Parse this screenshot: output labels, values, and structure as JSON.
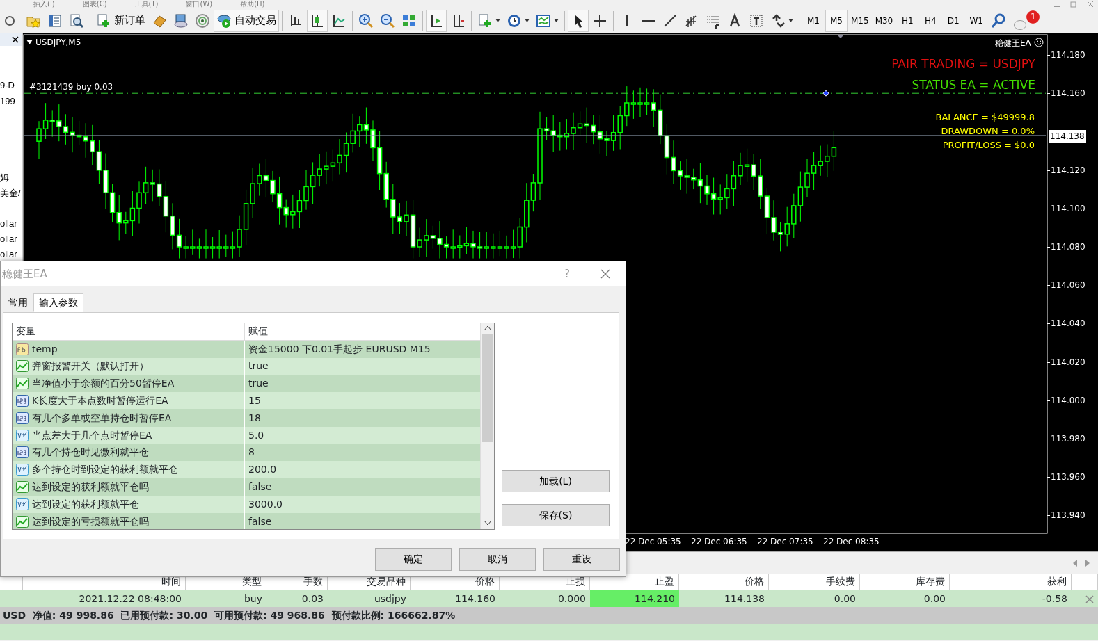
{
  "menu": [
    "插入(I)",
    "图表(C)",
    "工具(T)",
    "窗口(W)",
    "帮助(H)"
  ],
  "toolbar": {
    "new_order": "新订单",
    "auto_trading": "自动交易",
    "notification_count": "1",
    "timeframes": [
      {
        "label": "M1",
        "selected": false
      },
      {
        "label": "M5",
        "selected": true
      },
      {
        "label": "M15",
        "selected": false
      },
      {
        "label": "M30",
        "selected": false
      },
      {
        "label": "H1",
        "selected": false
      },
      {
        "label": "H4",
        "selected": false
      },
      {
        "label": "D1",
        "selected": false
      },
      {
        "label": "W1",
        "selected": false
      }
    ]
  },
  "navigator": {
    "fragments": [
      "9-D",
      "199",
      "姆",
      "美金/",
      "ollar",
      "ollar",
      "ollar"
    ]
  },
  "chart": {
    "title": "USDJPY,M5",
    "order_label": "#3121439 buy 0.03",
    "ea_name": "稳健王EA",
    "pair_line": "PAIR TRADING = USDJPY",
    "status_line": "STATUS EA = ACTIVE",
    "stats": [
      "BALANCE = $49999.8",
      "DRAWDOWN = 0.0%",
      "PROFIT/LOSS = $0.0"
    ],
    "price_axis": [
      "114.180",
      "114.160",
      "114.120",
      "114.100",
      "114.080",
      "114.060",
      "114.040",
      "114.020",
      "114.000",
      "113.980",
      "113.960",
      "113.940"
    ],
    "current_price": "114.138",
    "time_axis": [
      "22 Dec 05:35",
      "22 Dec 06:35",
      "22 Dec 07:35",
      "22 Dec 08:35"
    ]
  },
  "dialog": {
    "title": "稳健王EA",
    "help": "?",
    "tabs": [
      {
        "label": "常用",
        "selected": false
      },
      {
        "label": "输入参数",
        "selected": true
      }
    ],
    "columns": [
      "变量",
      "赋值"
    ],
    "params": [
      {
        "kind": "string",
        "name": "temp",
        "value": "资金15000  下0.01手起步  EURUSD M15"
      },
      {
        "kind": "bool",
        "name": "弹窗报警开关（默认打开）",
        "value": "true"
      },
      {
        "kind": "bool",
        "name": "当净值小于余额的百分50暂停EA",
        "value": "true"
      },
      {
        "kind": "int",
        "name": "K长度大于本点数时暂停运行EA",
        "value": "15"
      },
      {
        "kind": "int",
        "name": "有几个多单或空单持仓时暂停EA",
        "value": "18"
      },
      {
        "kind": "double",
        "name": "当点差大于几个点时暂停EA",
        "value": "5.0"
      },
      {
        "kind": "int",
        "name": "有几个持仓时见微利就平仓",
        "value": "8"
      },
      {
        "kind": "double",
        "name": "多个持仓时到设定的获利额就平仓",
        "value": "200.0"
      },
      {
        "kind": "bool",
        "name": "达到设定的获利额就平仓吗",
        "value": "false"
      },
      {
        "kind": "double",
        "name": "达到设定的获利额就平仓",
        "value": "3000.0"
      },
      {
        "kind": "bool",
        "name": "达到设定的亏损额就平仓吗",
        "value": "false"
      }
    ],
    "side_buttons": [
      "加载(L)",
      "保存(S)"
    ],
    "buttons": [
      "确定",
      "取消",
      "重设"
    ]
  },
  "terminal": {
    "columns": [
      "时间",
      "类型",
      "手数",
      "交易品种",
      "价格",
      "止损",
      "止盈",
      "价格",
      "手续费",
      "库存费",
      "获利"
    ],
    "rows": [
      {
        "cells": [
          {
            "text": "2021.12.22 08:48:00",
            "highlighted": false
          },
          {
            "text": "buy",
            "highlighted": false
          },
          {
            "text": "0.03",
            "highlighted": false
          },
          {
            "text": "usdjpy",
            "highlighted": false
          },
          {
            "text": "114.160",
            "highlighted": false
          },
          {
            "text": "0.000",
            "highlighted": false
          },
          {
            "text": "114.210",
            "highlighted": true
          },
          {
            "text": "114.138",
            "highlighted": false
          },
          {
            "text": "0.00",
            "highlighted": false
          },
          {
            "text": "0.00",
            "highlighted": false
          },
          {
            "text": "-0.58",
            "highlighted": false
          }
        ]
      }
    ],
    "status": "USD  净值: 49 998.86  已用预付款: 30.00  可用预付款: 49 968.86  预付款比例: 166662.87%"
  }
}
